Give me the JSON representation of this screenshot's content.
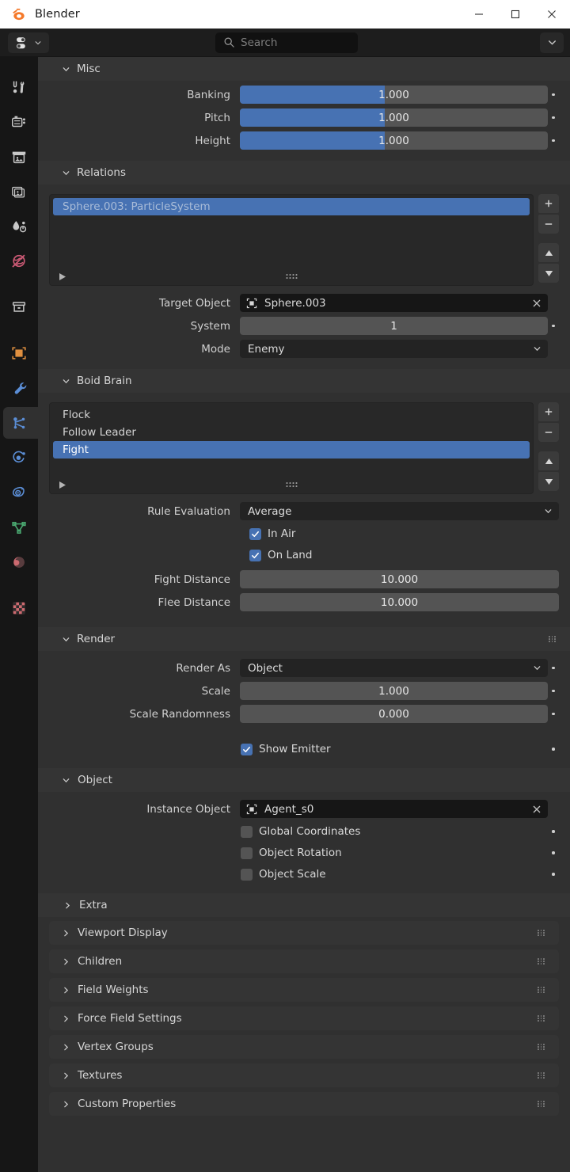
{
  "window": {
    "title": "Blender",
    "logo_icon": "blender-logo",
    "minimize_icon": "minimize-icon",
    "maximize_icon": "maximize-icon",
    "close_icon": "close-icon"
  },
  "header": {
    "editor_type_icon": "properties-editor-icon",
    "editor_type_chevron": "chevron-down-icon",
    "search_icon": "search-icon",
    "search_placeholder": "Search",
    "options_chevron": "chevron-down-icon"
  },
  "tab_rail": {
    "tabs": [
      {
        "name": "tool",
        "icon": "tool-icon",
        "color": "#c8c8c8",
        "active": false
      },
      {
        "name": "render",
        "icon": "render-camera-icon",
        "color": "#c8c8c8",
        "active": false
      },
      {
        "name": "output",
        "icon": "output-printer-icon",
        "color": "#c8c8c8",
        "active": false
      },
      {
        "name": "view-layer",
        "icon": "view-layer-images-icon",
        "color": "#c8c8c8",
        "active": false
      },
      {
        "name": "scene",
        "icon": "scene-cone-icon",
        "color": "#c8c8c8",
        "active": false
      },
      {
        "name": "world",
        "icon": "world-globe-icon",
        "color": "#cc5a75",
        "active": false
      },
      {
        "name": "collection",
        "icon": "collection-box-icon",
        "color": "#c8c8c8",
        "active": false
      },
      {
        "name": "object",
        "icon": "object-square-icon",
        "color": "#e09040",
        "active": false
      },
      {
        "name": "modifiers",
        "icon": "wrench-icon",
        "color": "#5b8ed6",
        "active": false
      },
      {
        "name": "particles",
        "icon": "particles-icon",
        "color": "#5b8ed6",
        "active": true
      },
      {
        "name": "physics",
        "icon": "physics-orbit-icon",
        "color": "#5b8ed6",
        "active": false
      },
      {
        "name": "constraints",
        "icon": "constraints-icon",
        "color": "#5b8ed6",
        "active": false
      },
      {
        "name": "data",
        "icon": "object-data-triangle-icon",
        "color": "#4aa870",
        "active": false
      },
      {
        "name": "material",
        "icon": "material-sphere-icon",
        "color": "#cc6a70",
        "active": false
      },
      {
        "name": "texture",
        "icon": "texture-checker-icon",
        "color": "#cc6a70",
        "active": false
      }
    ]
  },
  "panels": {
    "misc": {
      "title": "Misc",
      "expand_icon": "chevron-down-icon",
      "fields": [
        {
          "label": "Banking",
          "value": "1.000",
          "fill_pct": 47,
          "type": "slider",
          "animatable": true
        },
        {
          "label": "Pitch",
          "value": "1.000",
          "fill_pct": 47,
          "type": "slider",
          "animatable": true
        },
        {
          "label": "Height",
          "value": "1.000",
          "fill_pct": 47,
          "type": "slider",
          "animatable": true
        }
      ]
    },
    "relations": {
      "title": "Relations",
      "expand_icon": "chevron-down-icon",
      "list": {
        "items": [
          {
            "label": "Sphere.003: ParticleSystem",
            "selected": true,
            "dim": true
          }
        ],
        "add_icon": "plus-icon",
        "remove_icon": "minus-icon",
        "move_up_icon": "triangle-up-icon",
        "move_down_icon": "triangle-down-icon",
        "filter_icon": "play-triangle-icon",
        "resize_grip_icon": "grip-dots-icon"
      },
      "target_object": {
        "label": "Target Object",
        "value": "Sphere.003",
        "icon": "object-data-icon",
        "clear_icon": "x-icon"
      },
      "system": {
        "label": "System",
        "value": "1",
        "animatable": true
      },
      "mode": {
        "label": "Mode",
        "value": "Enemy",
        "chevron": "chevron-down-icon"
      }
    },
    "boid_brain": {
      "title": "Boid Brain",
      "expand_icon": "chevron-down-icon",
      "list": {
        "items": [
          {
            "label": "Flock",
            "selected": false
          },
          {
            "label": "Follow Leader",
            "selected": false
          },
          {
            "label": "Fight",
            "selected": true
          }
        ],
        "add_icon": "plus-icon",
        "remove_icon": "minus-icon",
        "move_up_icon": "triangle-up-icon",
        "move_down_icon": "triangle-down-icon",
        "filter_icon": "play-triangle-icon",
        "resize_grip_icon": "grip-dots-icon"
      },
      "rule_evaluation": {
        "label": "Rule Evaluation",
        "value": "Average",
        "chevron": "chevron-down-icon"
      },
      "in_air": {
        "label": "In Air",
        "checked": true
      },
      "on_land": {
        "label": "On Land",
        "checked": true
      },
      "fight_distance": {
        "label": "Fight Distance",
        "value": "10.000"
      },
      "flee_distance": {
        "label": "Flee Distance",
        "value": "10.000"
      }
    },
    "render": {
      "title": "Render",
      "expand_icon": "chevron-down-icon",
      "grip_icon": "grip-dots-icon",
      "render_as": {
        "label": "Render As",
        "value": "Object",
        "chevron": "chevron-down-icon",
        "animatable": true
      },
      "scale": {
        "label": "Scale",
        "value": "1.000",
        "animatable": true
      },
      "scale_randomness": {
        "label": "Scale Randomness",
        "value": "0.000",
        "animatable": true
      },
      "show_emitter": {
        "label": "Show Emitter",
        "checked": true,
        "animatable": true
      }
    },
    "object": {
      "title": "Object",
      "expand_icon": "chevron-down-icon",
      "instance_object": {
        "label": "Instance Object",
        "value": "Agent_s0",
        "icon": "object-data-icon",
        "clear_icon": "x-icon"
      },
      "global_coordinates": {
        "label": "Global Coordinates",
        "checked": false,
        "animatable": true
      },
      "object_rotation": {
        "label": "Object Rotation",
        "checked": false,
        "animatable": true
      },
      "object_scale": {
        "label": "Object Scale",
        "checked": false,
        "animatable": true
      }
    },
    "extra": {
      "title": "Extra",
      "expand_icon": "chevron-right-icon"
    }
  },
  "collapsed_panels": [
    {
      "title": "Viewport Display",
      "expand_icon": "chevron-right-icon",
      "grip_icon": "grip-dots-icon"
    },
    {
      "title": "Children",
      "expand_icon": "chevron-right-icon",
      "grip_icon": "grip-dots-icon"
    },
    {
      "title": "Field Weights",
      "expand_icon": "chevron-right-icon",
      "grip_icon": "grip-dots-icon"
    },
    {
      "title": "Force Field Settings",
      "expand_icon": "chevron-right-icon",
      "grip_icon": "grip-dots-icon"
    },
    {
      "title": "Vertex Groups",
      "expand_icon": "chevron-right-icon",
      "grip_icon": "grip-dots-icon"
    },
    {
      "title": "Textures",
      "expand_icon": "chevron-right-icon",
      "grip_icon": "grip-dots-icon"
    },
    {
      "title": "Custom Properties",
      "expand_icon": "chevron-right-icon",
      "grip_icon": "grip-dots-icon"
    }
  ],
  "colors": {
    "accent_blue": "#4772b3",
    "panel_bg": "#303030",
    "panel_head": "#343434",
    "rail_bg": "#161616",
    "field_bg": "#545454",
    "dark_field": "#232323"
  }
}
